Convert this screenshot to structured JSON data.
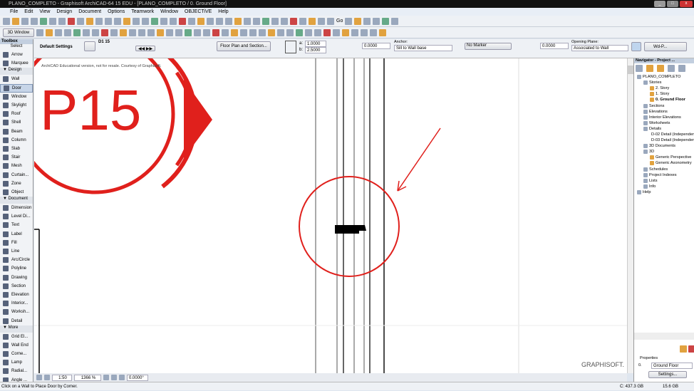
{
  "window": {
    "title": "PLANO_COMPLETO - Graphisoft ArchiCAD-64 15 EDU - [PLANO_COMPLETO / 0. Ground Floor]"
  },
  "menu": [
    "File",
    "Edit",
    "View",
    "Design",
    "Document",
    "Options",
    "Teamwork",
    "Window",
    "OBJECTiVE",
    "Help"
  ],
  "toolbar": {
    "view3d": "3D Window",
    "go": "Go"
  },
  "info": {
    "default_settings": "Default Settings",
    "door_id": "D1 15",
    "floor_plan_button": "Floor Plan and Section...",
    "a_label": "a:",
    "a_value": "1.0000",
    "b_label": "b:",
    "b_value": "2.5000",
    "sill_value": "0.0000",
    "anchor_label": "Anchor:",
    "anchor_value": "Sill to Wall base",
    "marker_value": "No Marker",
    "elev_value": "0.0000",
    "opening_plane_label": "Opening Plane:",
    "opening_plane_value": "Associated to Wall",
    "favorite": "Wd-P..."
  },
  "toolbox": {
    "title": "Toolbox",
    "select": "Select",
    "sections": [
      {
        "name": "",
        "items": [
          "Arrow",
          "Marquee"
        ]
      },
      {
        "name": "Design",
        "items": [
          "Wall",
          "Door",
          "Window",
          "Skylight",
          "Roof",
          "Shell",
          "Beam",
          "Column",
          "Slab",
          "Stair",
          "Mesh",
          "Curtain...",
          "Zone",
          "Object"
        ]
      },
      {
        "name": "Document",
        "items": [
          "Dimension",
          "Level Di...",
          "Text",
          "Label",
          "Fill",
          "Line",
          "Arc/Circle",
          "Polyline",
          "Drawing",
          "Section",
          "Elevation",
          "Interior...",
          "Worksh...",
          "Detail"
        ]
      },
      {
        "name": "More",
        "items": [
          "Grid El...",
          "Wall End",
          "Corne...",
          "Lamp",
          "Radial...",
          "Angle ..."
        ]
      }
    ],
    "selected": "Door"
  },
  "canvas": {
    "watermark": "ArchiCAD Educational version, not for resale. Courtesy of Graphisoft.",
    "stamp": "P15",
    "logo": "GRAPHISOFT."
  },
  "bottom": {
    "scale": "1:50",
    "zoom": "1366 %",
    "angle": "0.0000°"
  },
  "navigator": {
    "title": "Navigator - Project ...",
    "tree": [
      {
        "l": 0,
        "t": "PLANO_COMPLETO"
      },
      {
        "l": 1,
        "t": "Stories"
      },
      {
        "l": 2,
        "t": "2. Story"
      },
      {
        "l": 2,
        "t": "1. Story"
      },
      {
        "l": 2,
        "t": "0. Ground Floor",
        "sel": true
      },
      {
        "l": 1,
        "t": "Sections"
      },
      {
        "l": 1,
        "t": "Elevations"
      },
      {
        "l": 1,
        "t": "Interior Elevations"
      },
      {
        "l": 1,
        "t": "Worksheets"
      },
      {
        "l": 1,
        "t": "Details"
      },
      {
        "l": 2,
        "t": "D-02 Detail (Independent)"
      },
      {
        "l": 2,
        "t": "D-03 Detail (Independent)"
      },
      {
        "l": 1,
        "t": "3D Documents"
      },
      {
        "l": 1,
        "t": "3D"
      },
      {
        "l": 2,
        "t": "Generic Perspective"
      },
      {
        "l": 2,
        "t": "Generic Axonometry"
      },
      {
        "l": 1,
        "t": "Schedules"
      },
      {
        "l": 1,
        "t": "Project Indexes"
      },
      {
        "l": 1,
        "t": "Lists"
      },
      {
        "l": 1,
        "t": "Info"
      },
      {
        "l": 0,
        "t": "Help"
      }
    ],
    "properties_label": "Properties",
    "prop_id": "0.",
    "prop_value": "Ground Floor",
    "settings_button": "Settings..."
  },
  "status": {
    "message": "Click on a Wall to Place Door by Corner.",
    "disk": "C: 437.3 GB",
    "ram": "15.6 GB"
  },
  "colors": {
    "annotation_red": "#e0201c"
  }
}
